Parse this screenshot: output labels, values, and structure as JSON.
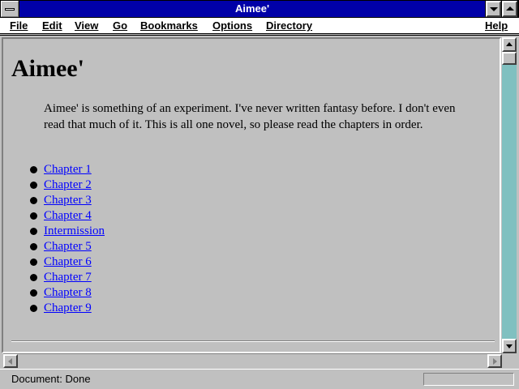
{
  "window": {
    "title": "Aimee'"
  },
  "menu": {
    "items": [
      {
        "label": "File",
        "accel": "F"
      },
      {
        "label": "Edit",
        "accel": "E"
      },
      {
        "label": "View",
        "accel": "V"
      },
      {
        "label": "Go",
        "accel": "G"
      },
      {
        "label": "Bookmarks",
        "accel": "B"
      },
      {
        "label": "Options",
        "accel": "O"
      },
      {
        "label": "Directory",
        "accel": "D"
      },
      {
        "label": "Help",
        "accel": "H"
      }
    ]
  },
  "page": {
    "title": "Aimee'",
    "intro": "Aimee' is something of an experiment. I've never written fantasy before. I don't even read that much of it. This is all one novel, so please read the chapters in order.",
    "chapters": [
      "Chapter 1",
      "Chapter 2",
      "Chapter 3",
      "Chapter 4",
      "Intermission",
      "Chapter 5",
      "Chapter 6",
      "Chapter 7",
      "Chapter 8",
      "Chapter 9"
    ],
    "link_color": "#0000ff"
  },
  "status": {
    "text": "Document: Done"
  },
  "colors": {
    "titlebar": "#0000a8",
    "scroll_track": "#80c0c0",
    "chrome": "#c0c0c0"
  },
  "icons": {
    "system_menu": "system-menu-icon",
    "minimize": "chevron-down-icon",
    "maximize": "chevron-up-icon",
    "scroll_up": "arrow-up-icon",
    "scroll_down": "arrow-down-icon",
    "scroll_left": "arrow-left-icon",
    "scroll_right": "arrow-right-icon"
  }
}
